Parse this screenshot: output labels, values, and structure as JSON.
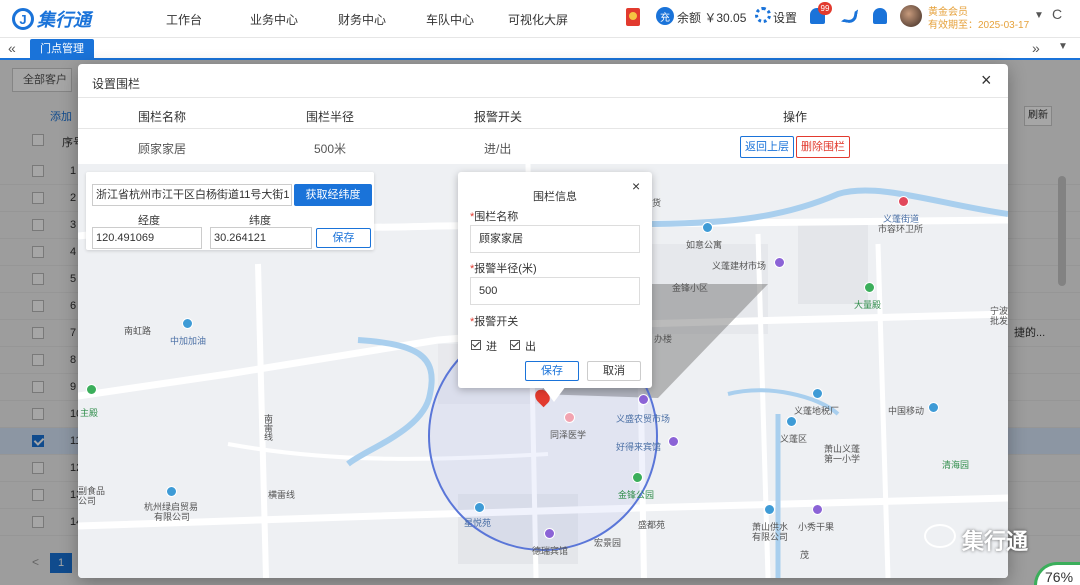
{
  "brand": {
    "name": "集行通",
    "mark": "J"
  },
  "nav": [
    "工作台",
    "业务中心",
    "财务中心",
    "车队中心",
    "可视化大屏"
  ],
  "header": {
    "charge_icon": "充",
    "balance": "余额 ￥30.05",
    "settings": "设置",
    "notify_count": "99",
    "member": "黄金会员",
    "expire": "有效期至：2025-03-17",
    "caret": "▼",
    "refresh": "C"
  },
  "tabs": {
    "prev": "«",
    "active": "门点管理",
    "next": "»",
    "down": "▼"
  },
  "bg": {
    "filter": "全部客户",
    "add": "添加",
    "refresh": "刷新",
    "col_no": "序号",
    "rows": [
      "1",
      "2",
      "3",
      "4",
      "5",
      "6",
      "7",
      "8",
      "9",
      "10",
      "11",
      "12",
      "13",
      "14"
    ],
    "page": "1",
    "prev": "<",
    "right_text": "捷的..."
  },
  "modal": {
    "title": "设置围栏",
    "close": "×",
    "headers": [
      "围栏名称",
      "围栏半径",
      "报警开关",
      "操作"
    ],
    "row": {
      "name": "顾家家居",
      "radius": "500米",
      "alarm": "进/出"
    },
    "btn_back": "返回上层",
    "btn_delete": "删除围栏"
  },
  "search": {
    "address": "浙江省杭州市江干区白杨街道11号大街1",
    "btn_latlng": "获取经纬度",
    "lng_label": "经度",
    "lat_label": "纬度",
    "lng": "120.491069",
    "lat": "30.264121",
    "save": "保存"
  },
  "popup": {
    "title": "围栏信息",
    "close": "×",
    "required_mark": "*",
    "name_label": "围栏名称",
    "name_value": "顾家家居",
    "radius_label": "报警半径(米)",
    "radius_value": "500",
    "alarm_label": "报警开关",
    "in_label": "进",
    "out_label": "出",
    "save": "保存",
    "cancel": "取消"
  },
  "map_labels": [
    {
      "text": "义蓬街道",
      "c": "dark"
    },
    {
      "text": "市容环卫所",
      "c": "dark"
    },
    {
      "text": "如意公寓",
      "c": "dark"
    },
    {
      "text": "义蓬建材市场",
      "c": "dark"
    },
    {
      "text": "金锋小区",
      "c": "dark"
    },
    {
      "text": "大量殿",
      "c": "green"
    },
    {
      "text": "南虹路",
      "c": "dark"
    },
    {
      "text": "中加加油",
      "c": "blue"
    },
    {
      "text": "办楼",
      "c": "dark"
    },
    {
      "text": "义盛农贸市场",
      "c": "blue"
    },
    {
      "text": "同泽医学",
      "c": "dark"
    },
    {
      "text": "义蓬地税厂",
      "c": "dark"
    },
    {
      "text": "中国移动",
      "c": "dark"
    },
    {
      "text": "义蓬区",
      "c": "dark"
    },
    {
      "text": "萧山义蓬",
      "c": "dark"
    },
    {
      "text": "第一小学",
      "c": "dark"
    },
    {
      "text": "好得来宾馆",
      "c": "blue"
    },
    {
      "text": "清海园",
      "c": "green"
    },
    {
      "text": "横雷线",
      "c": "dark"
    },
    {
      "text": "南雷线",
      "c": "dark"
    },
    {
      "text": "杭州绿启贸易",
      "c": "dark"
    },
    {
      "text": "有限公司",
      "c": "dark"
    },
    {
      "text": "副食品",
      "c": "dark"
    },
    {
      "text": "公司",
      "c": "dark"
    },
    {
      "text": "金锋公园",
      "c": "green"
    },
    {
      "text": "盛都苑",
      "c": "dark"
    },
    {
      "text": "萧山供水",
      "c": "dark"
    },
    {
      "text": "有限公司",
      "c": "dark"
    },
    {
      "text": "小秀干果",
      "c": "dark"
    },
    {
      "text": "星悦苑",
      "c": "blue"
    },
    {
      "text": "宏景园",
      "c": "dark"
    },
    {
      "text": "德瑞宾馆",
      "c": "dark"
    },
    {
      "text": "主殿",
      "c": "green"
    },
    {
      "text": "宁波",
      "c": "dark"
    },
    {
      "text": "批发",
      "c": "dark"
    },
    {
      "text": "茂",
      "c": "dark"
    },
    {
      "text": "货",
      "c": "dark"
    }
  ],
  "watermark": "集行通",
  "zoom": "76%",
  "colors": {
    "primary": "#1a73d9",
    "danger": "#e23a2e",
    "member": "#e6a23c"
  }
}
